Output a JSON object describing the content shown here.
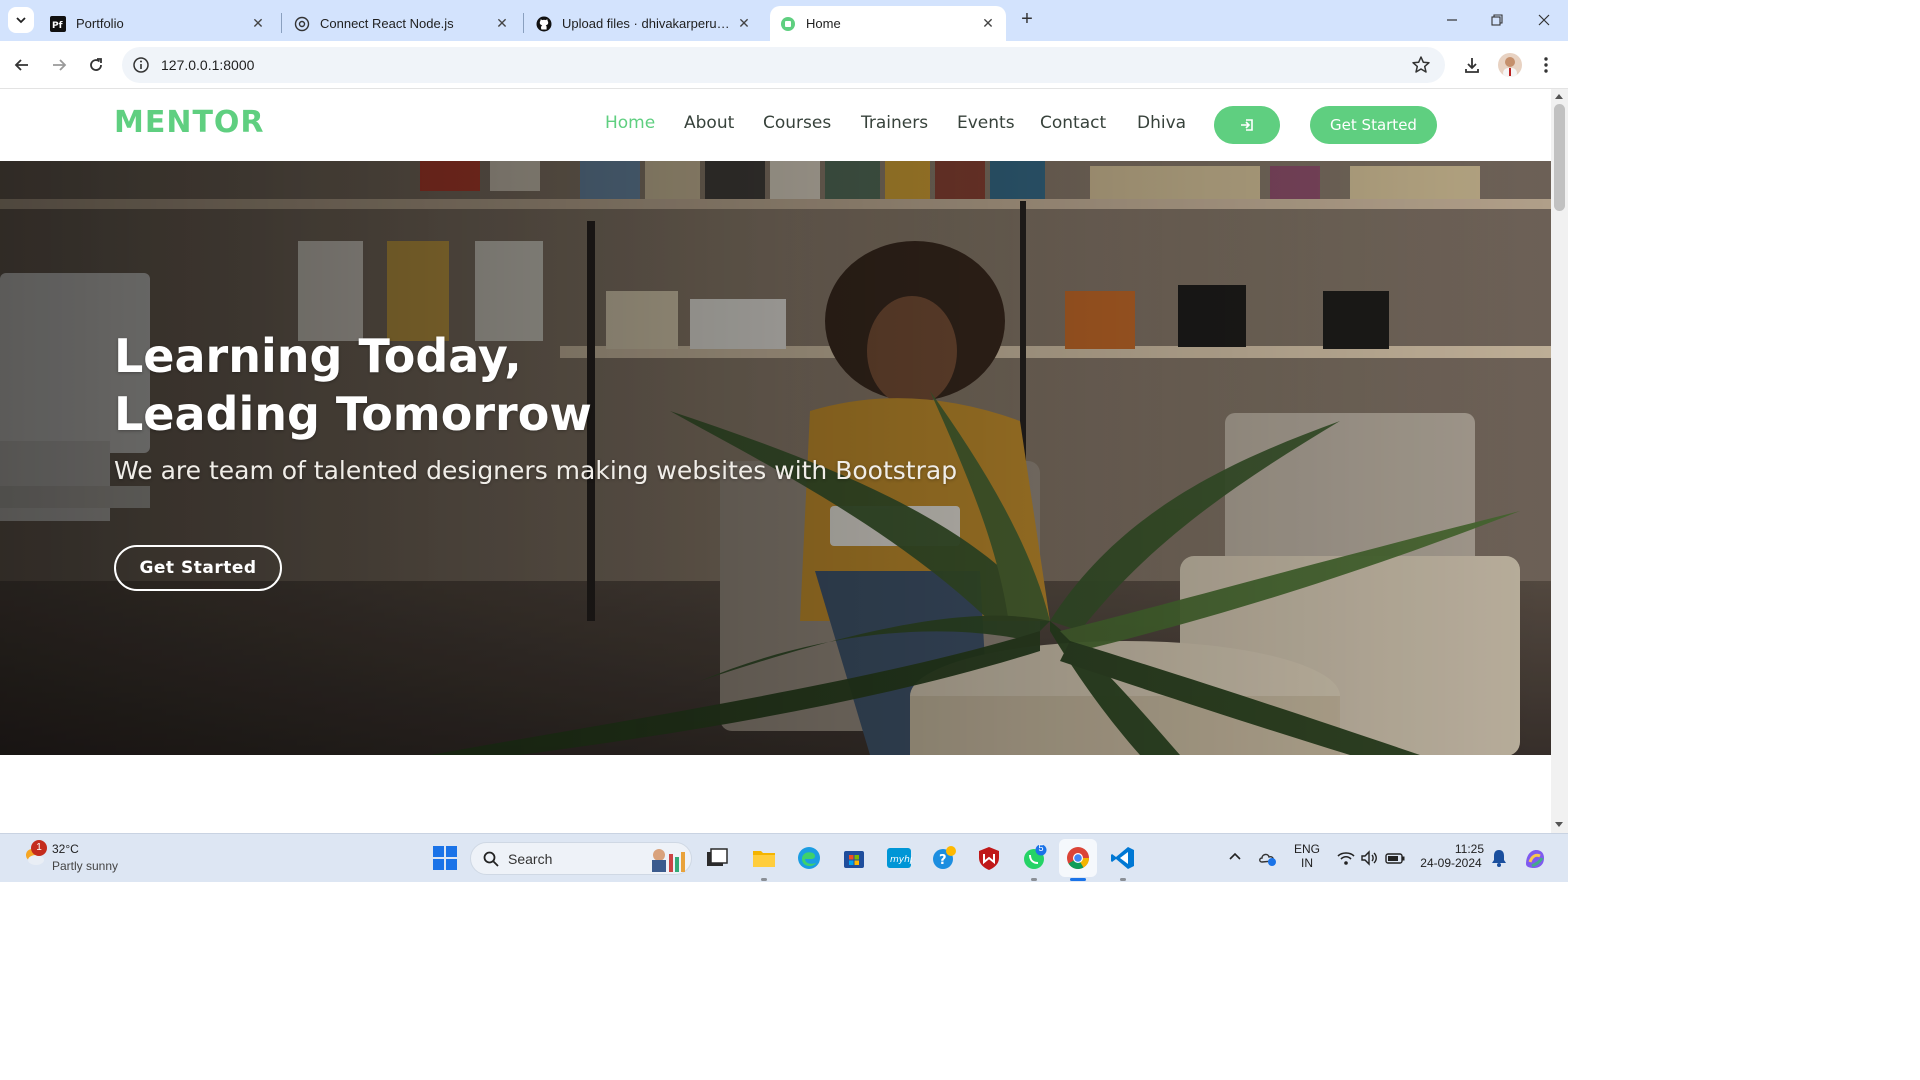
{
  "browser": {
    "tabs": [
      {
        "title": "Portfolio",
        "favicon": "pf-favicon",
        "active": false
      },
      {
        "title": "Connect React Node.js",
        "favicon": "chatgpt-favicon",
        "active": false
      },
      {
        "title": "Upload files · dhivakarperumal/",
        "favicon": "github-favicon",
        "active": false
      },
      {
        "title": "Home",
        "favicon": "site-favicon",
        "active": true
      }
    ],
    "url": "127.0.0.1:8000"
  },
  "site": {
    "logo": "MENTOR",
    "nav": [
      {
        "label": "Home",
        "active": true
      },
      {
        "label": "About",
        "active": false
      },
      {
        "label": "Courses",
        "active": false
      },
      {
        "label": "Trainers",
        "active": false
      },
      {
        "label": "Events",
        "active": false
      },
      {
        "label": "Contact",
        "active": false
      },
      {
        "label": "Dhiva",
        "active": false
      }
    ],
    "header_cta": "Get Started",
    "accent_color": "#5fcf80",
    "hero": {
      "title_line1": "Learning Today,",
      "title_line2": "Leading Tomorrow",
      "subtitle": "We are team of talented designers making websites with Bootstrap",
      "cta": "Get Started"
    }
  },
  "taskbar": {
    "weather_temp": "32°C",
    "weather_desc": "Partly sunny",
    "weather_badge": "1",
    "search_label": "Search",
    "whatsapp_badge": "5",
    "language_line1": "ENG",
    "language_line2": "IN",
    "time": "11:25",
    "date": "24-09-2024"
  }
}
